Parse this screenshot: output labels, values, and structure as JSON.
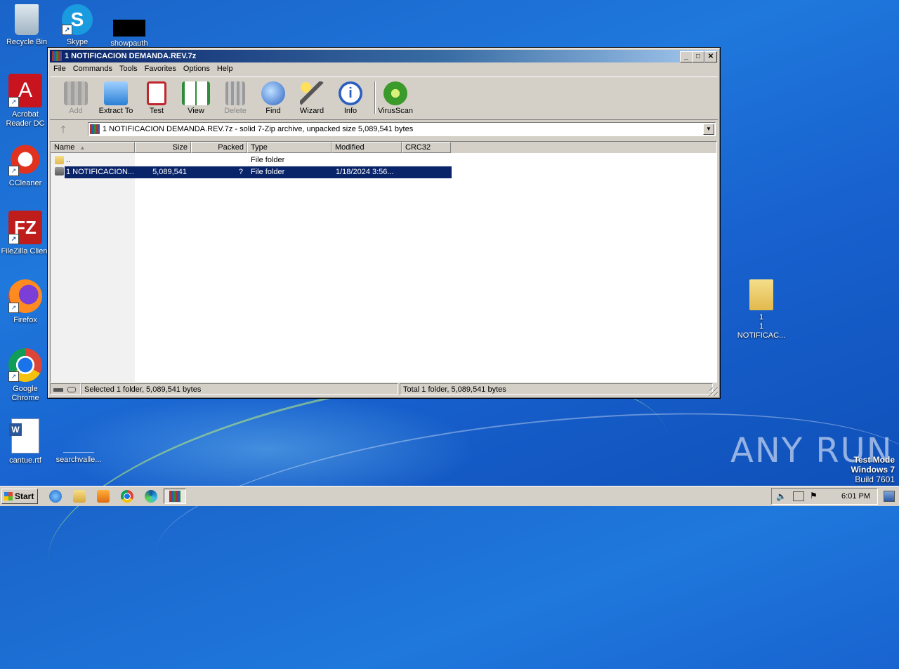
{
  "desktop": {
    "icons": [
      {
        "label": "Recycle Bin"
      },
      {
        "label": "Skype"
      },
      {
        "label": "showpauth"
      },
      {
        "label": "Acrobat Reader DC"
      },
      {
        "label": "CCleaner"
      },
      {
        "label": "FileZilla Client"
      },
      {
        "label": "Firefox"
      },
      {
        "label": "Google Chrome"
      },
      {
        "label": "cantue.rtf"
      },
      {
        "label": "searchvalle..."
      },
      {
        "label": "1 NOTIFICAC..."
      }
    ],
    "watermark": "ANY RUN",
    "test_mode": {
      "line1": "Test Mode",
      "line2": "Windows 7",
      "line3": "Build 7601"
    }
  },
  "window": {
    "title": "1 NOTIFICACION DEMANDA.REV.7z",
    "menu": [
      "File",
      "Commands",
      "Tools",
      "Favorites",
      "Options",
      "Help"
    ],
    "toolbar": [
      {
        "label": "Add",
        "icon": "add-archive-icon",
        "enabled": false
      },
      {
        "label": "Extract To",
        "icon": "folder-extract-icon",
        "enabled": true
      },
      {
        "label": "Test",
        "icon": "test-clipboard-icon",
        "enabled": true
      },
      {
        "label": "View",
        "icon": "book-view-icon",
        "enabled": true
      },
      {
        "label": "Delete",
        "icon": "trash-icon",
        "enabled": false
      },
      {
        "label": "Find",
        "icon": "magnifier-icon",
        "enabled": true
      },
      {
        "label": "Wizard",
        "icon": "magic-wand-icon",
        "enabled": true
      },
      {
        "label": "Info",
        "icon": "info-icon",
        "enabled": true
      },
      {
        "label": "VirusScan",
        "icon": "virus-scan-icon",
        "enabled": true
      }
    ],
    "address": "1 NOTIFICACION DEMANDA.REV.7z - solid 7-Zip archive, unpacked size 5,089,541 bytes",
    "columns": [
      "Name",
      "Size",
      "Packed",
      "Type",
      "Modified",
      "CRC32"
    ],
    "rows": [
      {
        "name": "..",
        "size": "",
        "packed": "",
        "type": "File folder",
        "modified": "",
        "crc": "",
        "selected": false
      },
      {
        "name": "1 NOTIFICACION...",
        "size": "5,089,541",
        "packed": "?",
        "type": "File folder",
        "modified": "1/18/2024 3:56...",
        "crc": "",
        "selected": true
      }
    ],
    "status_left": "Selected 1 folder, 5,089,541 bytes",
    "status_right": "Total 1 folder, 5,089,541 bytes"
  },
  "taskbar": {
    "start_label": "Start",
    "clock": "6:01 PM"
  }
}
